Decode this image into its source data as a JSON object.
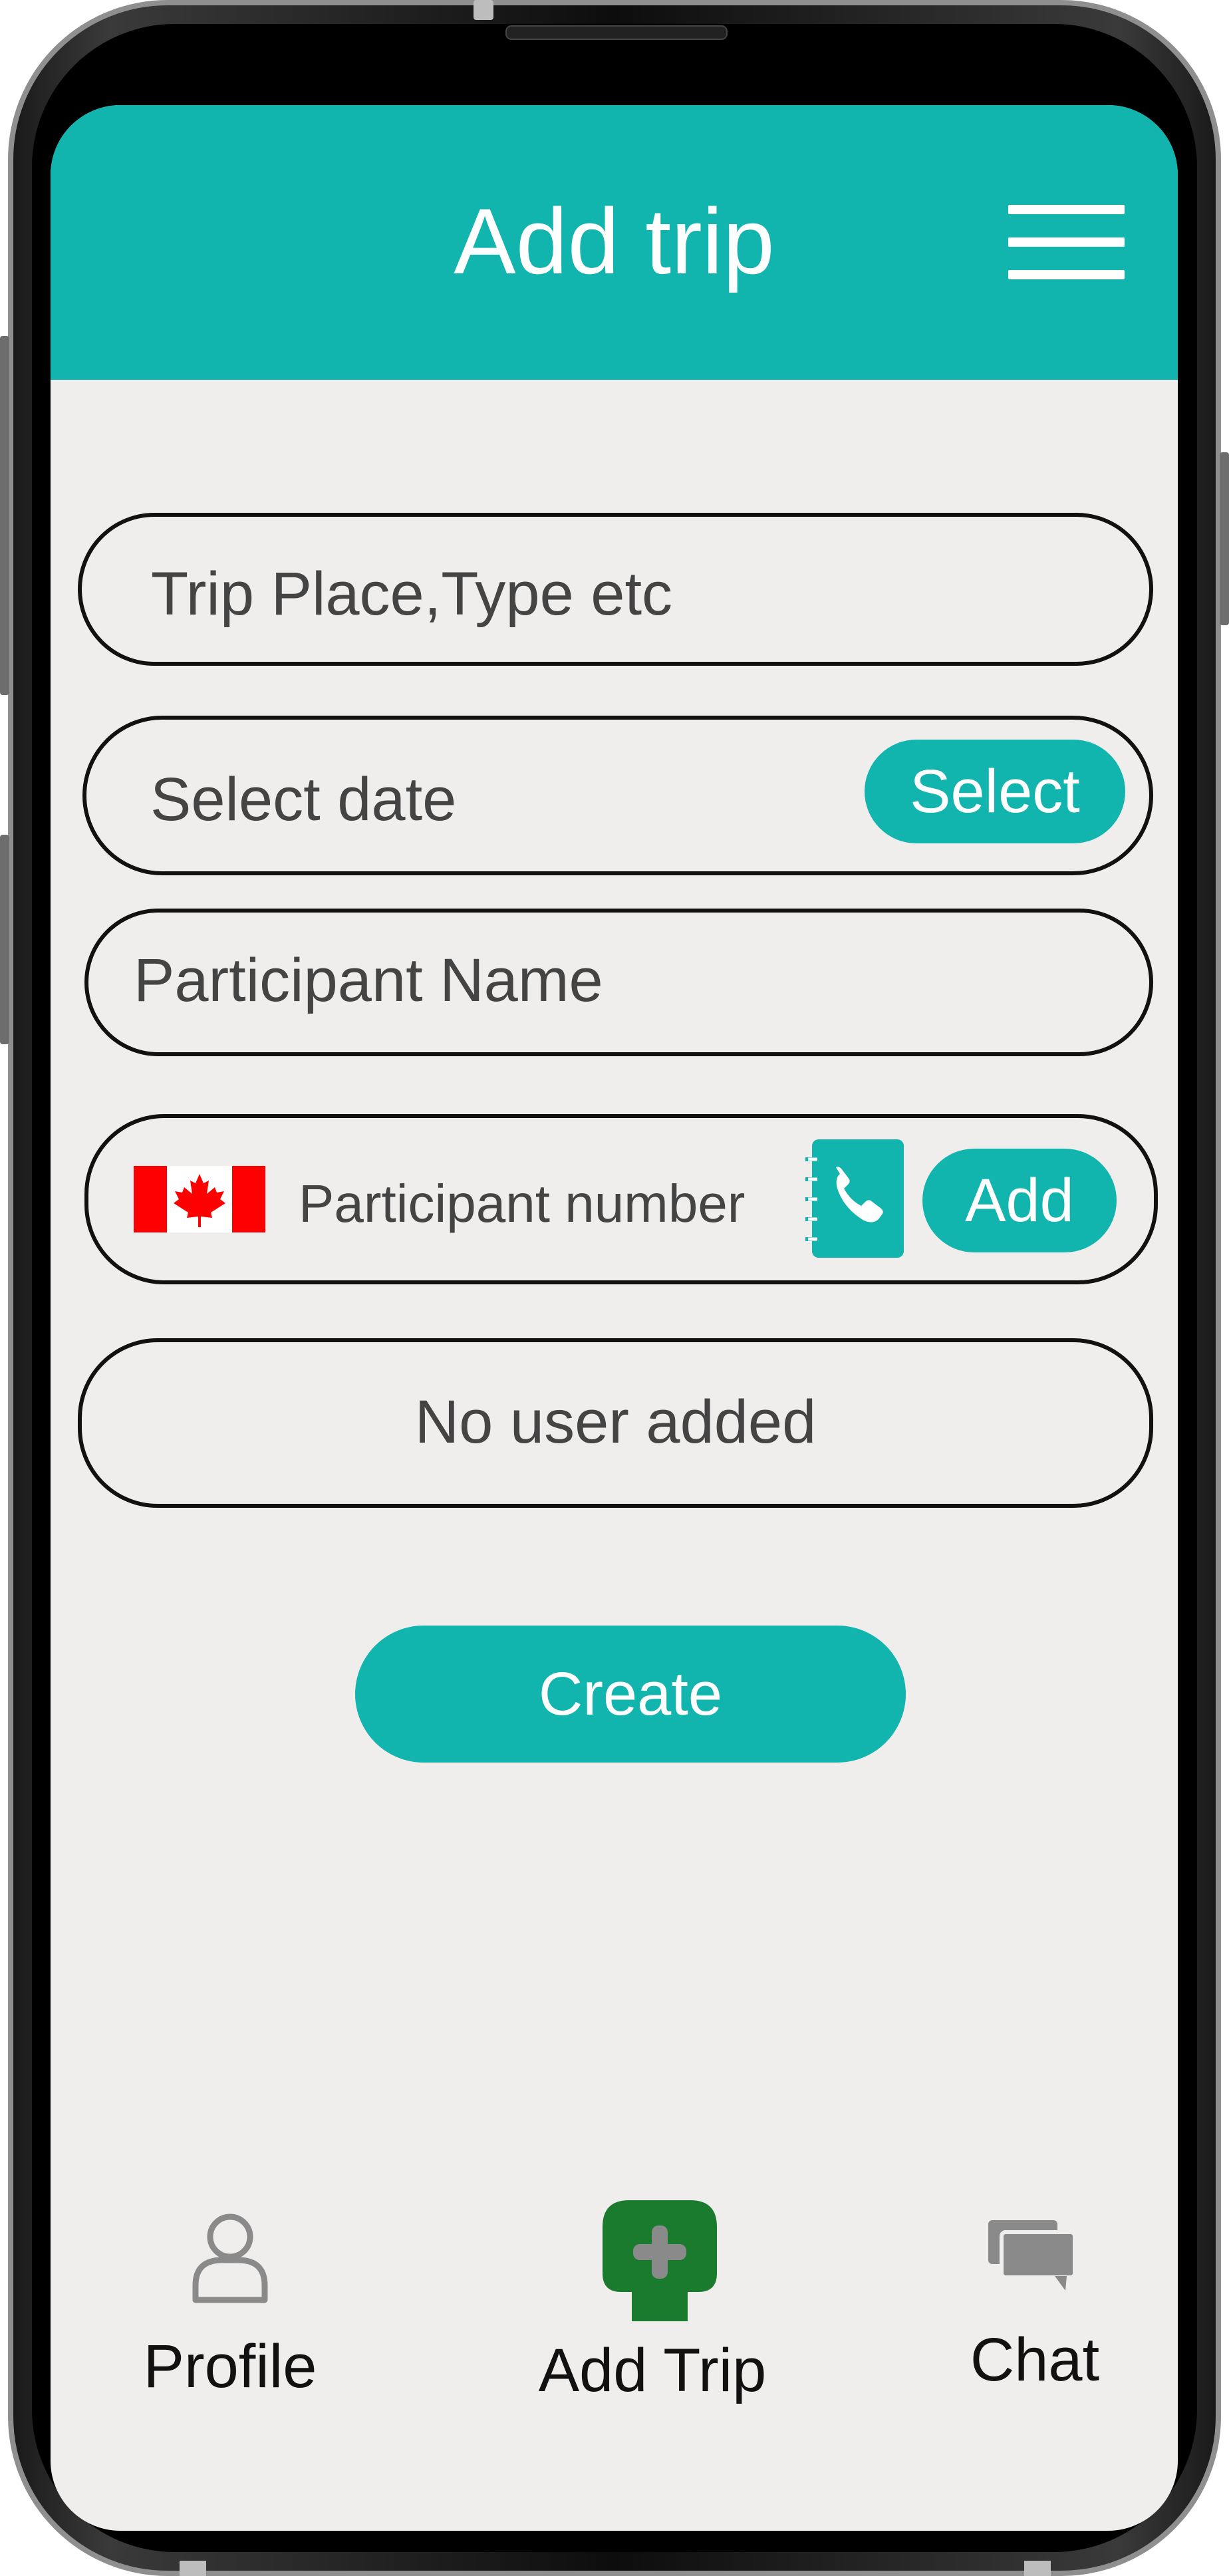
{
  "header": {
    "title": "Add trip"
  },
  "form": {
    "trip_place_placeholder": "Trip Place,Type etc",
    "date_label": "Select date",
    "date_select_button": "Select",
    "participant_name_placeholder": "Participant Name",
    "participant_number_placeholder": "Participant number",
    "add_button": "Add",
    "no_user_text": "No user added",
    "create_button": "Create"
  },
  "bottom_nav": {
    "items": [
      {
        "label": "Profile",
        "icon": "user-icon"
      },
      {
        "label": "Add Trip",
        "icon": "plus-icon",
        "active": true
      },
      {
        "label": "Chat",
        "icon": "chat-icon"
      }
    ]
  },
  "colors": {
    "accent": "#11b5ae",
    "screen_bg": "#f0eeed",
    "active_nav": "#1a7a2e",
    "inactive_icon": "#8a8a8a"
  }
}
